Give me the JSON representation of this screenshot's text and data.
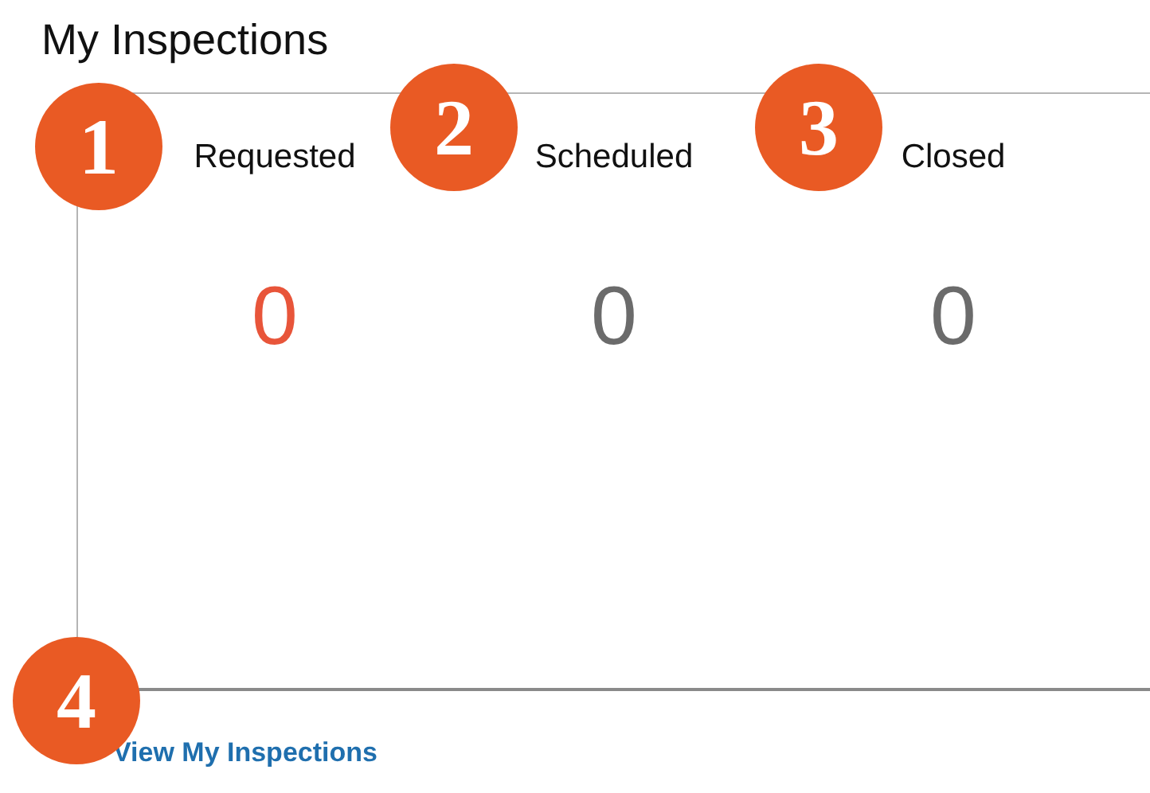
{
  "title": "My Inspections",
  "counters": [
    {
      "label": "Requested",
      "count": "0",
      "color": "#e8553a"
    },
    {
      "label": "Scheduled",
      "count": "0",
      "color": "#6b6b6b"
    },
    {
      "label": "Closed",
      "count": "0",
      "color": "#6b6b6b"
    }
  ],
  "callouts": [
    {
      "label": "1"
    },
    {
      "label": "2"
    },
    {
      "label": "3"
    },
    {
      "label": "4"
    }
  ],
  "link": {
    "label": "View My Inspections"
  }
}
